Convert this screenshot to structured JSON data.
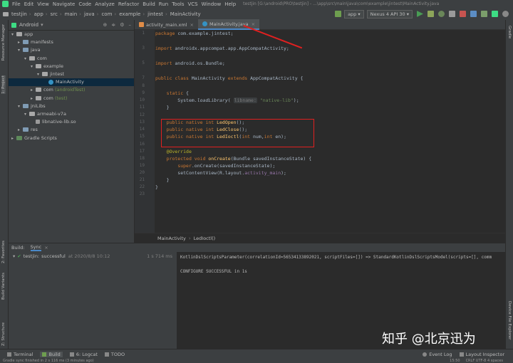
{
  "menu": {
    "items": [
      "File",
      "Edit",
      "View",
      "Navigate",
      "Code",
      "Analyze",
      "Refactor",
      "Build",
      "Run",
      "Tools",
      "VCS",
      "Window",
      "Help"
    ],
    "title": "testjin [G:\\android\\PRO\\testjin] - ...\\app\\src\\main\\java\\com\\example\\jintest\\MainActivity.java"
  },
  "nav": {
    "crumbs": [
      "testjin",
      "app",
      "src",
      "main",
      "java",
      "com",
      "example",
      "jintest",
      "MainActivity"
    ],
    "run_config": "app",
    "device": "Nexus 4 API 30"
  },
  "left_strip": {
    "labels": [
      "Resource Manager",
      "1: Project",
      "2: Favorites",
      "Build Variants",
      "Z: Structure"
    ]
  },
  "right_strip": {
    "labels": [
      "Gradle",
      "Device File Explorer"
    ]
  },
  "project": {
    "view": "Android",
    "tree": [
      {
        "label": "app",
        "indent": 0,
        "kind": "folder",
        "open": true
      },
      {
        "label": "manifests",
        "indent": 1,
        "kind": "folder",
        "open": false
      },
      {
        "label": "java",
        "indent": 1,
        "kind": "folder",
        "open": true
      },
      {
        "label": "com",
        "indent": 2,
        "kind": "folder",
        "open": true
      },
      {
        "label": "example",
        "indent": 3,
        "kind": "folder",
        "open": true
      },
      {
        "label": "jintest",
        "indent": 4,
        "kind": "folder",
        "open": true
      },
      {
        "label": "MainActivity",
        "indent": 5,
        "kind": "class",
        "open": false,
        "selected": true
      },
      {
        "label": "com",
        "suffix": "(androidTest)",
        "indent": 3,
        "kind": "folder",
        "open": false
      },
      {
        "label": "com",
        "suffix": "(test)",
        "indent": 3,
        "kind": "folder",
        "open": false
      },
      {
        "label": "jniLibs",
        "indent": 1,
        "kind": "folder",
        "open": true
      },
      {
        "label": "armeabi-v7a",
        "indent": 2,
        "kind": "folder",
        "open": true
      },
      {
        "label": "libnative-lib.so",
        "indent": 3,
        "kind": "file",
        "open": false
      },
      {
        "label": "res",
        "indent": 1,
        "kind": "folder",
        "open": false
      },
      {
        "label": "Gradle Scripts",
        "indent": 0,
        "kind": "gradle",
        "open": false
      }
    ]
  },
  "editor": {
    "tabs": [
      {
        "label": "activity_main.xml",
        "active": false
      },
      {
        "label": "MainActivity.java",
        "active": true
      }
    ],
    "line_numbers": [
      "1",
      "",
      "3",
      "",
      "5",
      "",
      "7",
      "8",
      "9",
      "10",
      "11",
      "12",
      "13",
      "14",
      "15",
      "16",
      "17",
      "18",
      "19",
      "20",
      "21",
      "22",
      "23"
    ],
    "breadcrumb": [
      "MainActivity",
      "LedIoctl()"
    ]
  },
  "build": {
    "tab_label": "Build:",
    "sync_label": "Sync",
    "item_project": "testjin:",
    "item_status": "successful",
    "item_time": "at 2020/8/8 10:12",
    "item_duration": "1 s 714 ms",
    "log_line1": "KotlinDslScriptsParameter(correlationId=56534133892021, scriptFiles=[]) => StandardKotlinDslScriptsModel(scripts=[], comm",
    "log_line2": "CONFIGURE SUCCESSFUL in 1s"
  },
  "bottom": {
    "tools": [
      "Terminal",
      "Build",
      "6: Logcat",
      "TODO"
    ],
    "right_tools": [
      "Event Log",
      "Layout Inspector"
    ]
  },
  "status": {
    "text": "Gradle sync finished in 2 s 116 ms (3 minutes ago)",
    "pos": "15:50",
    "enc": "CRLF  UTF-8  4 spaces"
  },
  "watermark": "知乎 @北京迅为",
  "colors": {
    "accent": "#4a88c7",
    "annotation_red": "#e02020",
    "success": "#499c54"
  }
}
